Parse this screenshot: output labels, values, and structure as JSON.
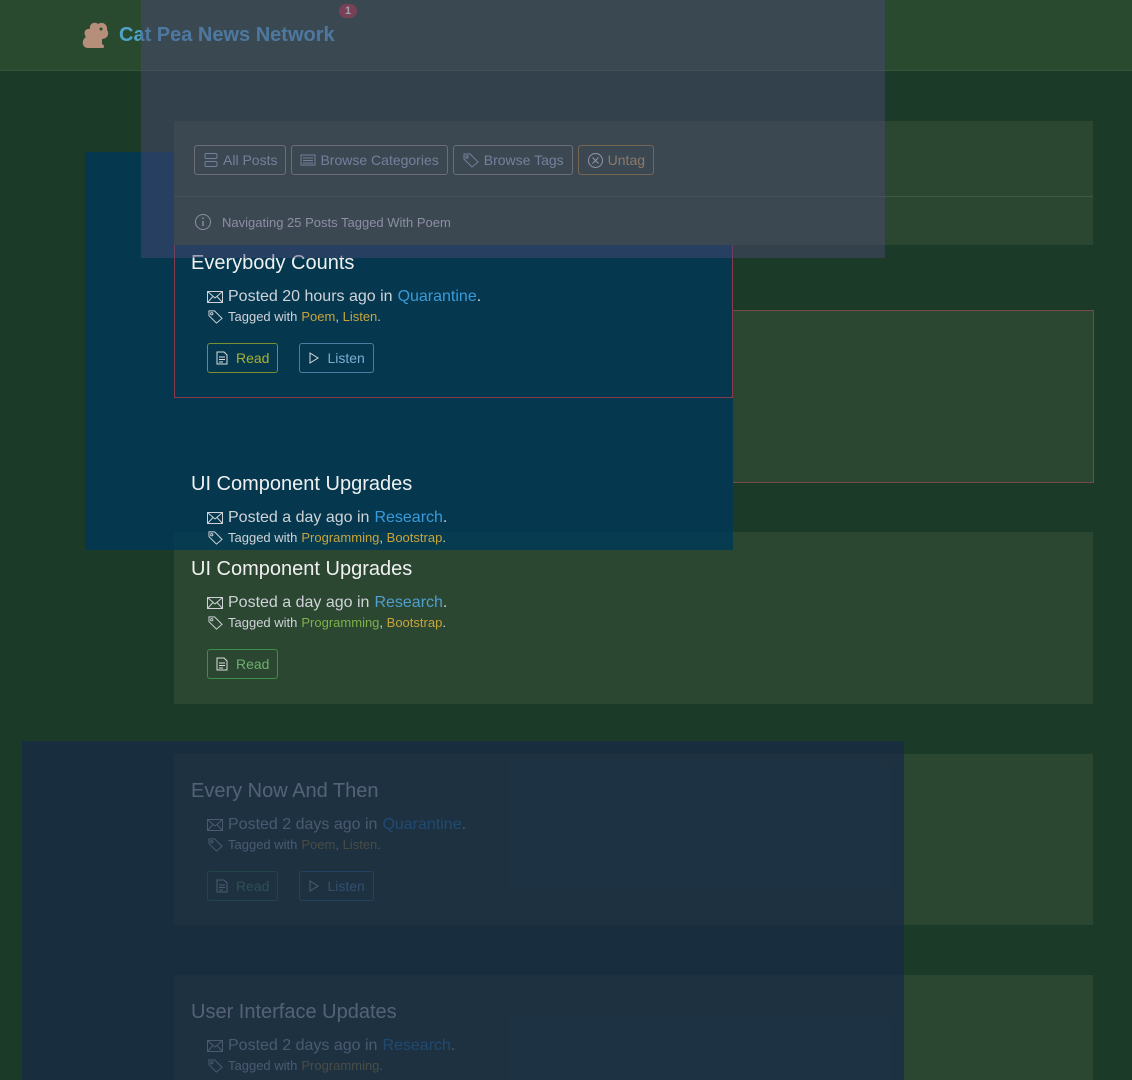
{
  "navbar": {
    "brand_name": "Cat Pea News Network",
    "notification_count": "1",
    "logo_icon": "squirrel-icon"
  },
  "toolbar": {
    "buttons": [
      {
        "label": "All Posts",
        "icon": "list-icon"
      },
      {
        "label": "Browse Categories",
        "icon": "categories-icon"
      },
      {
        "label": "Browse Tags",
        "icon": "tag-icon"
      },
      {
        "label": "Untag",
        "icon": "close-circle-icon"
      }
    ],
    "info_text": "Navigating 25 Posts Tagged With Poem"
  },
  "posts": [
    {
      "title": "Everybody Counts",
      "posted_prefix": "Posted 20 hours ago in",
      "category": "Quarantine",
      "tagged_prefix": "Tagged with",
      "tags": [
        "Poem",
        "Listen"
      ],
      "read_label": "Read",
      "listen_label": "Listen"
    },
    {
      "title": "UI Component Upgrades",
      "posted_prefix": "Posted a day ago in",
      "category": "Research",
      "tagged_prefix": "Tagged with",
      "tags": [
        "Programming",
        "Bootstrap"
      ]
    },
    {
      "title": "UI Component Upgrades",
      "posted_prefix": "Posted a day ago in",
      "category": "Research",
      "tagged_prefix": "Tagged with",
      "tags": [
        "Programming",
        "Bootstrap"
      ],
      "read_label": "Read"
    },
    {
      "title": "Every Now And Then",
      "posted_prefix": "Posted 2 days ago in",
      "category": "Quarantine",
      "tagged_prefix": "Tagged with",
      "tags": [
        "Poem",
        "Listen"
      ],
      "read_label": "Read",
      "listen_label": "Listen"
    },
    {
      "title": "User Interface Updates",
      "posted_prefix": "Posted 2 days ago in",
      "category": "Research",
      "tagged_prefix": "Tagged with",
      "tags": [
        "Programming"
      ]
    }
  ],
  "colors": {
    "brand": "#4fa3c7",
    "category_link": "#3a9ad9",
    "tag_link": "#c9a43a",
    "badge": "#a23a3a"
  }
}
